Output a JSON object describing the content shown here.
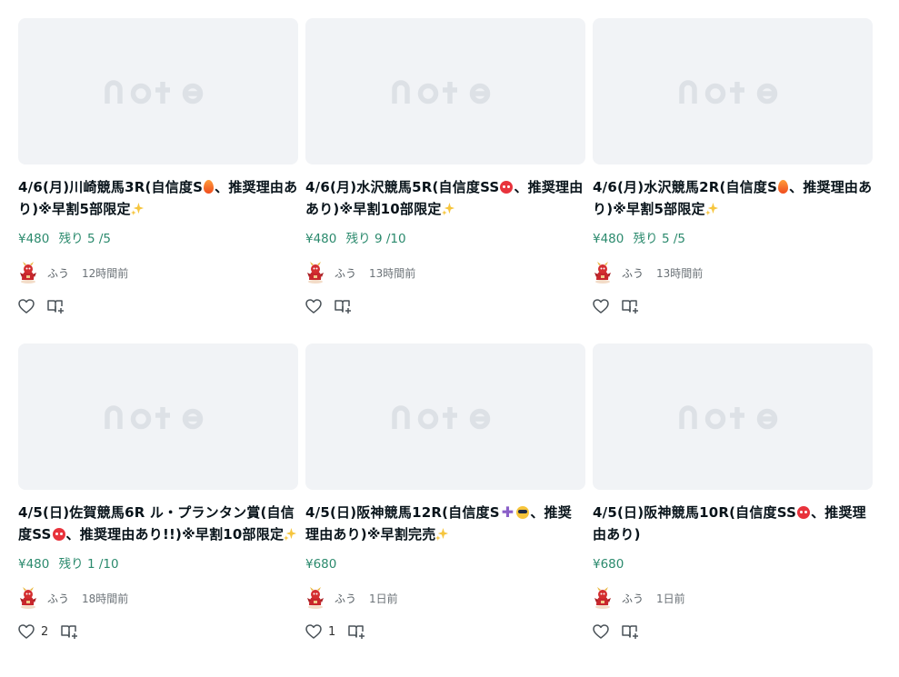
{
  "cards": [
    {
      "logo_text": "note",
      "title_parts": [
        "4/6(月)川崎競馬3R(自信度S",
        "fire",
        "、推奨理由あり)※早割5部限定",
        "sparkles"
      ],
      "price": "¥480",
      "remaining": "残り 5 /5",
      "author": "ふう",
      "time": "12時間前",
      "likes": ""
    },
    {
      "logo_text": "note",
      "title_parts": [
        "4/6(月)水沢競馬5R(自信度SS",
        "angry",
        "、推奨理由あり)※早割10部限定",
        "sparkles"
      ],
      "price": "¥480",
      "remaining": "残り 9 /10",
      "author": "ふう",
      "time": "13時間前",
      "likes": ""
    },
    {
      "logo_text": "note",
      "title_parts": [
        "4/6(月)水沢競馬2R(自信度S",
        "fire",
        "、推奨理由あり)※早割5部限定",
        "sparkles"
      ],
      "price": "¥480",
      "remaining": "残り 5 /5",
      "author": "ふう",
      "time": "13時間前",
      "likes": ""
    },
    {
      "logo_text": "note",
      "title_parts": [
        "4/5(日)佐賀競馬6R ル・プランタン賞(自信度SS",
        "angry",
        "、推奨理由あり!!)※早割10部限定",
        "sparkles"
      ],
      "price": "¥480",
      "remaining": "残り 1 /10",
      "author": "ふう",
      "time": "18時間前",
      "likes": "2"
    },
    {
      "logo_text": "note",
      "title_parts": [
        "4/5(日)阪神競馬12R(自信度S",
        "plus",
        "cool",
        "、推奨理由あり)※早割完売",
        "sparkles"
      ],
      "price": "¥680",
      "remaining": "",
      "author": "ふう",
      "time": "1日前",
      "likes": "1"
    },
    {
      "logo_text": "note",
      "title_parts": [
        "4/5(日)阪神競馬10R(自信度SS",
        "angry",
        "、推奨理由あり)"
      ],
      "price": "¥680",
      "remaining": "",
      "author": "ふう",
      "time": "1日前",
      "likes": ""
    }
  ],
  "icons": {
    "fire": "fire-emoji",
    "sparkles": "sparkles-emoji",
    "angry": "angry-face-emoji",
    "plus": "heavy-plus-emoji",
    "cool": "sunglasses-face-emoji",
    "heart": "heart-icon",
    "magazine": "add-to-magazine-icon",
    "avatar": "red-dragon-avatar"
  },
  "colors": {
    "thumb_bg": "#f1f3f6",
    "logo": "#dde1e6",
    "price": "#2b8a6d",
    "title": "#08131a"
  }
}
